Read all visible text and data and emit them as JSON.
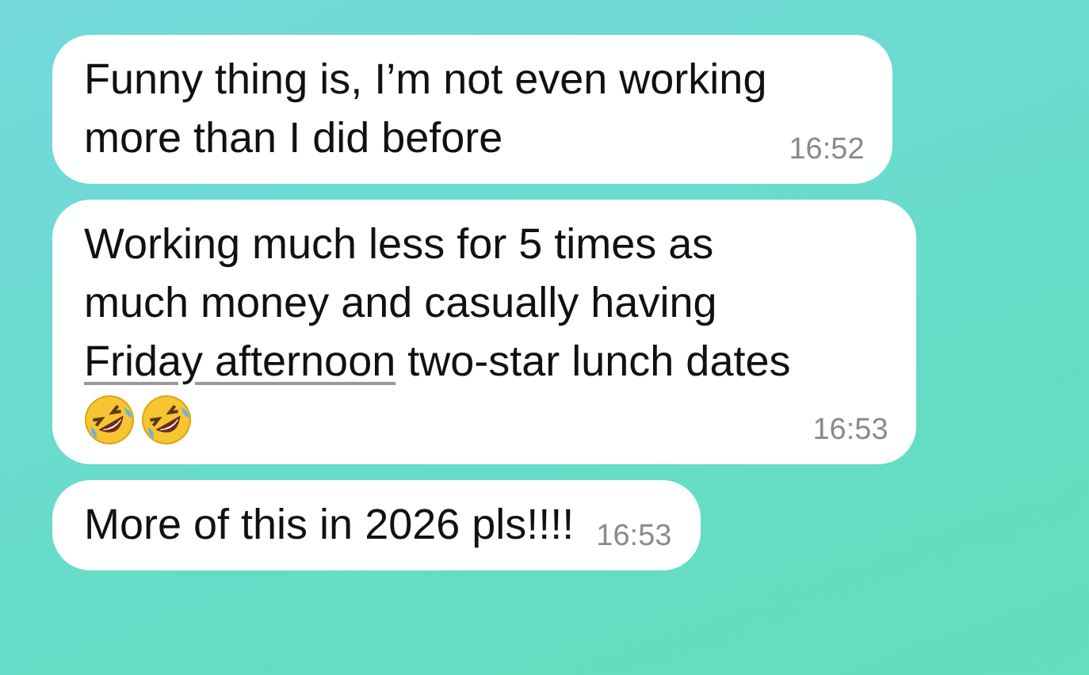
{
  "messages": [
    {
      "lines": [
        [
          {
            "text": "Funny thing is, I’m not even working"
          }
        ],
        [
          {
            "text": "more than I did before"
          }
        ]
      ],
      "time": "16:52"
    },
    {
      "lines": [
        [
          {
            "text": "Working much less for 5 times as"
          }
        ],
        [
          {
            "text": "much money and casually having"
          }
        ],
        [
          {
            "text": "Friday afternoon",
            "kind": "link"
          },
          {
            "text": " two-star lunch dates"
          }
        ]
      ],
      "emojis": [
        {
          "kind": "laughing"
        },
        {
          "kind": "laughing"
        }
      ],
      "time": "16:53"
    },
    {
      "lines": [
        [
          {
            "text": "More of this in 2026 pls!!!!"
          }
        ]
      ],
      "time": "16:53"
    }
  ]
}
